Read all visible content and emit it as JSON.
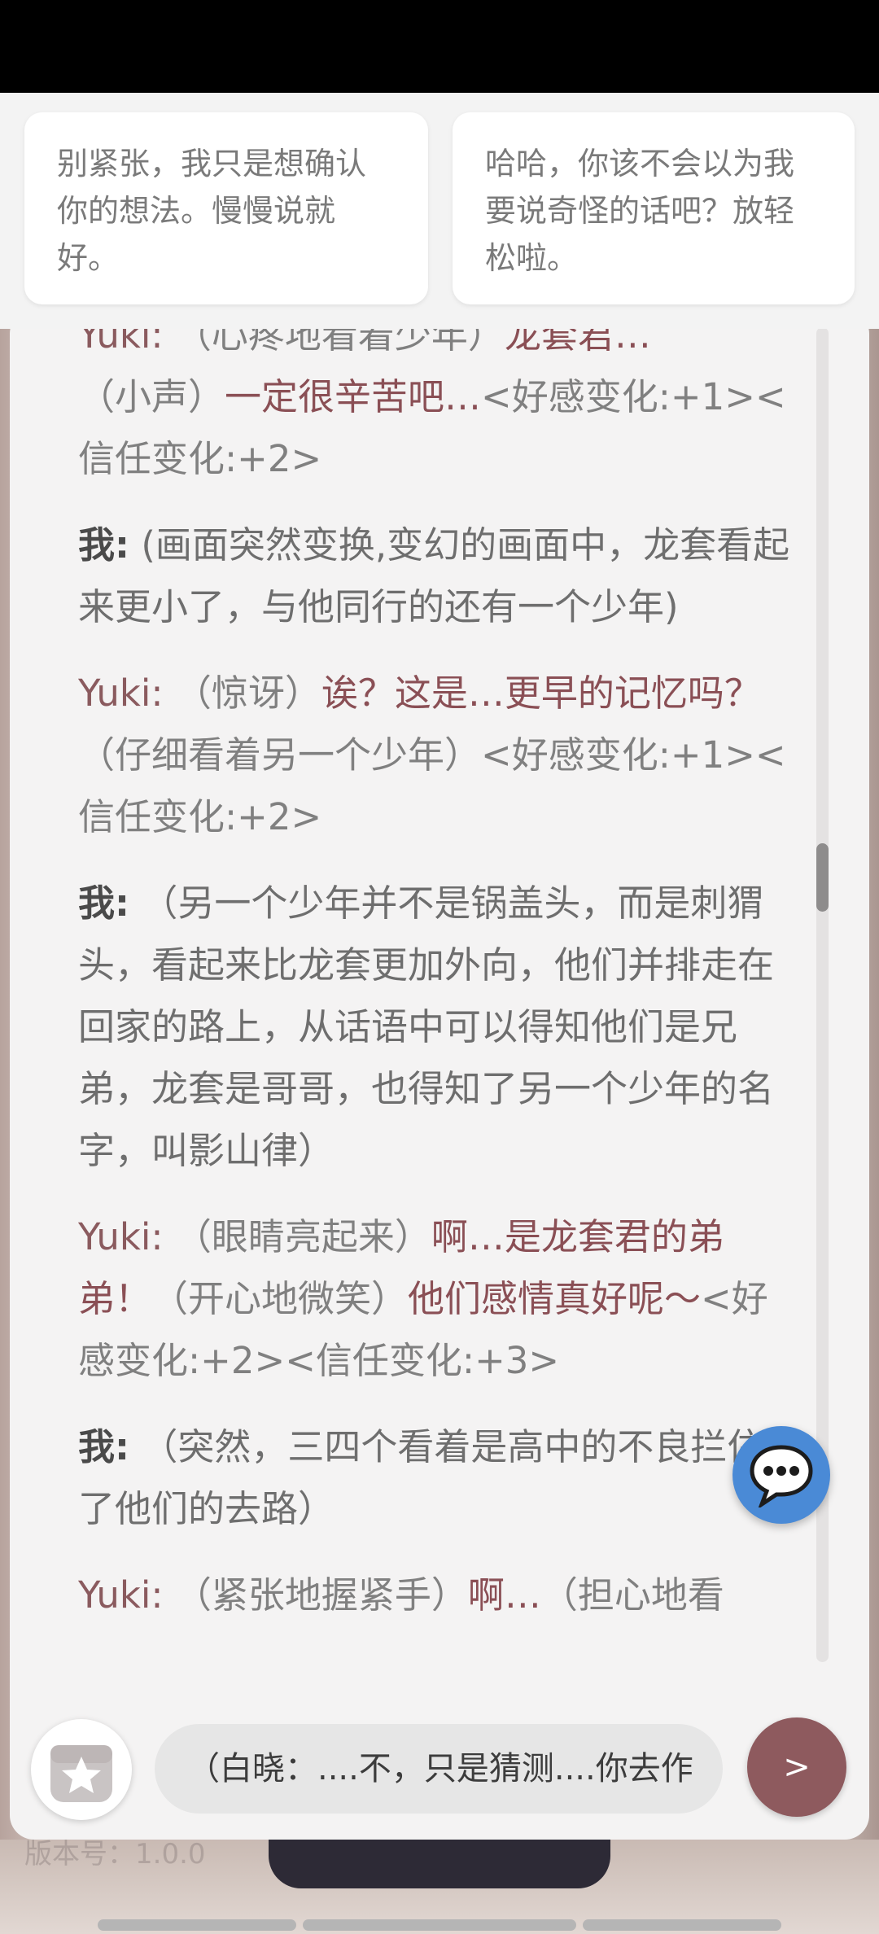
{
  "suggestions": [
    "别紧张，我只是想确认你的想法。慢慢说就好。",
    "哈哈，你该不会以为我要说奇怪的话吧？放轻松啦。"
  ],
  "messages": [
    {
      "who": "Yuki:",
      "parts": [
        {
          "t": "（心疼地看着少年）",
          "k": "act"
        },
        {
          "t": "龙套君…",
          "k": "speech"
        },
        {
          "t": "（小声）",
          "k": "act"
        },
        {
          "t": "一定很辛苦吧…",
          "k": "speech"
        },
        {
          "t": "<好感变化:+1><信任变化:+2>",
          "k": "act"
        }
      ]
    },
    {
      "who": "我:",
      "text": "(画面突然变换,变幻的画面中，龙套看起来更小了，与他同行的还有一个少年)"
    },
    {
      "who": "Yuki:",
      "parts": [
        {
          "t": "（惊讶）",
          "k": "act"
        },
        {
          "t": "诶？这是…更早的记忆吗？",
          "k": "speech"
        },
        {
          "t": "（仔细看着另一个少年）<好感变化:+1><信任变化:+2>",
          "k": "act"
        }
      ]
    },
    {
      "who": "我:",
      "text": "（另一个少年并不是锅盖头，而是刺猬头，看起来比龙套更加外向，他们并排走在回家的路上，从话语中可以得知他们是兄弟，龙套是哥哥，也得知了另一个少年的名字，叫影山律）"
    },
    {
      "who": "Yuki:",
      "parts": [
        {
          "t": "（眼睛亮起来）",
          "k": "act"
        },
        {
          "t": "啊…是龙套君的弟弟！",
          "k": "speech"
        },
        {
          "t": "（开心地微笑）",
          "k": "act"
        },
        {
          "t": "他们感情真好呢～",
          "k": "speech"
        },
        {
          "t": "<好感变化:+2><信任变化:+3>",
          "k": "act"
        }
      ]
    },
    {
      "who": "我:",
      "text": "（突然，三四个看着是高中的不良拦住了他们的去路）"
    },
    {
      "who": "Yuki:",
      "parts": [
        {
          "t": "（紧张地握紧手）",
          "k": "act"
        },
        {
          "t": "啊…",
          "k": "speech"
        },
        {
          "t": "（担心地看",
          "k": "act"
        }
      ]
    }
  ],
  "input": {
    "value": "（白晓：....不，只是猜测....你去作"
  },
  "send_label": ">",
  "version": "版本号：1.0.0",
  "icons": {
    "chat": "speech-bubble-icon",
    "gift": "gift-star-icon"
  },
  "colors": {
    "accent": "#8e5a5e",
    "fab": "#4a8ad6"
  }
}
